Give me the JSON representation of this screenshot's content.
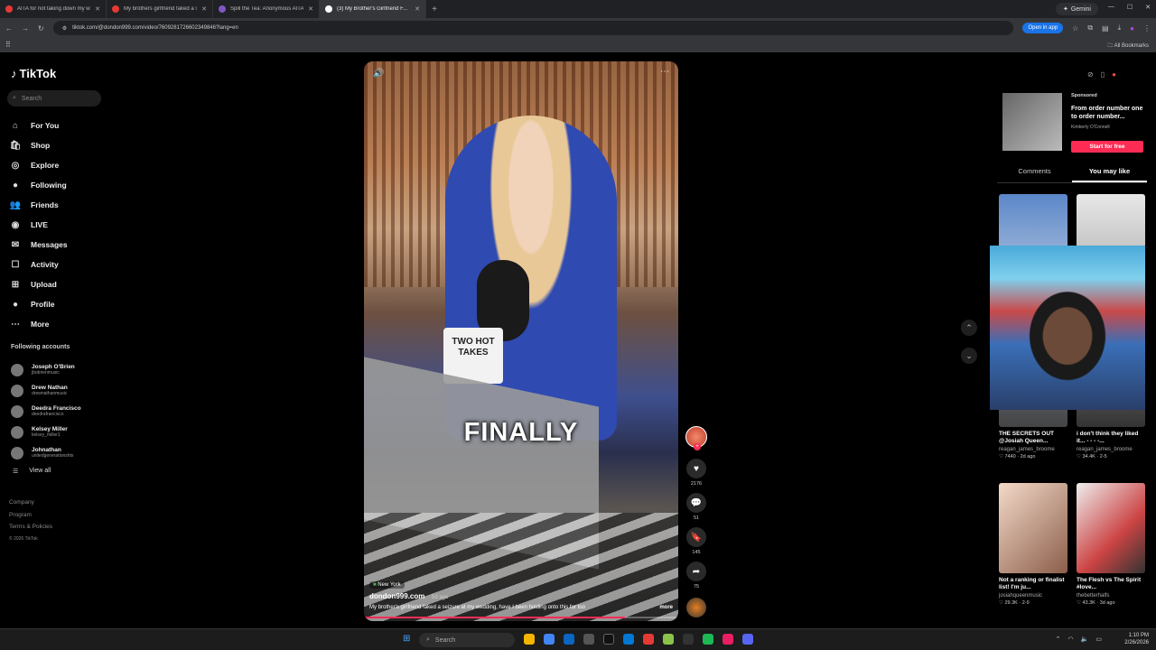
{
  "browser": {
    "tabs": [
      {
        "title": "AITA for not taking down my w...",
        "color": "#e53935",
        "active": false
      },
      {
        "title": "My brothers girlfriend faked a s...",
        "color": "#e53935",
        "active": false
      },
      {
        "title": "Spill the Tea: Anonymous AITA",
        "color": "#7e57c2",
        "active": false
      },
      {
        "title": "(3) My Brother's Girlfriend F...",
        "color": "#ffffff",
        "active": true
      }
    ],
    "gemini_label": "Gemini",
    "url": "tiktok.com/@dondon999.com/video/7609281726602349846?lang=en",
    "open_in_app": "Open in app",
    "all_bookmarks": "All Bookmarks"
  },
  "sidebar": {
    "logo": "TikTok",
    "search_placeholder": "Search",
    "nav": [
      {
        "label": "For You",
        "icon": "home-icon",
        "glyph": "⌂"
      },
      {
        "label": "Shop",
        "icon": "shop-icon",
        "glyph": "🛍"
      },
      {
        "label": "Explore",
        "icon": "compass-icon",
        "glyph": "◎"
      },
      {
        "label": "Following",
        "icon": "following-avatar-icon",
        "glyph": "●"
      },
      {
        "label": "Friends",
        "icon": "friends-icon",
        "glyph": "👥"
      },
      {
        "label": "LIVE",
        "icon": "live-icon",
        "glyph": "◉"
      },
      {
        "label": "Messages",
        "icon": "messages-icon",
        "glyph": "✉"
      },
      {
        "label": "Activity",
        "icon": "activity-icon",
        "glyph": "☐"
      },
      {
        "label": "Upload",
        "icon": "upload-icon",
        "glyph": "⊞"
      },
      {
        "label": "Profile",
        "icon": "profile-icon",
        "glyph": "●"
      },
      {
        "label": "More",
        "icon": "more-icon",
        "glyph": "⋯"
      }
    ],
    "following_title": "Following accounts",
    "accounts": [
      {
        "name": "Joseph O'Brien",
        "handle": "jbobrienmusic"
      },
      {
        "name": "Drew Nathan",
        "handle": "drewnathanmusic"
      },
      {
        "name": "Deedra Francisco",
        "handle": "deedrafrancisco"
      },
      {
        "name": "Kelsey Miller",
        "handle": "kelsey_miller1"
      },
      {
        "name": "Johnathan",
        "handle": "unitedgenerationshtx"
      }
    ],
    "view_all": "View all",
    "footer": [
      "Company",
      "Program",
      "Terms & Policies"
    ],
    "copyright": "© 2026 TikTok"
  },
  "video": {
    "caption_overlay": "FINALLY",
    "mug_text": "TWO HOT TAKES",
    "location": "New York",
    "author": "dondon999.com",
    "posted": "· 5d ago",
    "description": "My brother's girlfriend faked a seizure at my wedding, have I been holding onto this for too",
    "more": "more",
    "progress": 0.83
  },
  "actions": {
    "likes": "2176",
    "comments": "51",
    "saves": "145",
    "shares": "75"
  },
  "right_panel": {
    "ad": {
      "sponsored": "Sponsored",
      "title": "From order number one to order number...",
      "advertiser": "Kimberly O'Connell",
      "cta": "Start for free"
    },
    "tabs": [
      "Comments",
      "You may like"
    ],
    "cards": [
      {
        "title": "THE SECRETS OUT @Josiah Queen...",
        "user": "reagan_james_broome",
        "stats": "♡ 7440 · 2d ago"
      },
      {
        "title": "i don't think they liked it... - - - -...",
        "user": "reagan_james_broome",
        "stats": "♡ 34.4K · 2-5"
      },
      {
        "title": "Not a ranking or finalist list! I'm ju...",
        "user": "josiahqueenmusic",
        "stats": "♡ 29.3K · 2-9"
      },
      {
        "title": "The Flesh vs The Spirit #love...",
        "user": "thebetterhalfs",
        "stats": "♡ 43.3K · 3d ago"
      }
    ]
  },
  "taskbar": {
    "search": "Search",
    "time": "1:10 PM",
    "date": "2/26/2026"
  }
}
